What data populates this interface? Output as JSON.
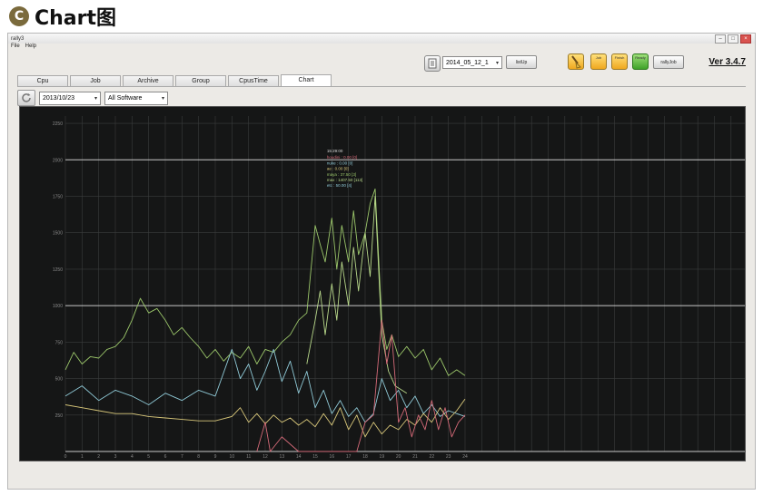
{
  "heading": {
    "badge": "C",
    "text": "Chart图"
  },
  "window": {
    "title": "rally3",
    "menu": [
      "File",
      "Help"
    ],
    "version": "Ver 3.4.7"
  },
  "toolbar": {
    "run_select": "2014_05_12_1",
    "load_label": "listUp",
    "folder_buttons": [
      "Job",
      "Finish",
      "Ready"
    ],
    "rally_job_label": "rallyJob"
  },
  "tabs": [
    {
      "label": "Cpu",
      "active": false
    },
    {
      "label": "Job",
      "active": false
    },
    {
      "label": "Archive",
      "active": false
    },
    {
      "label": "Group",
      "active": false
    },
    {
      "label": "CpusTime",
      "active": false
    },
    {
      "label": "Chart",
      "active": true
    }
  ],
  "filters": {
    "date": "2013/10/23",
    "software": "All Software"
  },
  "colors": {
    "green": "#9bc66a",
    "lightgreen": "#b8d88a",
    "cyan": "#8fc9d6",
    "yellow": "#d8c77a",
    "pink": "#d46a78",
    "grid": "#3a3c3c",
    "major": "#c8c8c8"
  },
  "chart_data": {
    "type": "line",
    "x_ticks": [
      "0",
      "1",
      "2",
      "3",
      "4",
      "5",
      "6",
      "7",
      "8",
      "9",
      "10",
      "11",
      "12",
      "13",
      "14",
      "15",
      "16",
      "17",
      "18",
      "19",
      "20",
      "21",
      "22",
      "23",
      "24"
    ],
    "y_ticks": [
      "250",
      "500",
      "750",
      "1000",
      "1250",
      "1500",
      "1750",
      "2000",
      "2250"
    ],
    "xlim": [
      0,
      24
    ],
    "ylim": [
      0,
      2300
    ],
    "grid": true,
    "tooltip": {
      "time": "15:29:00",
      "lines": [
        "houdini : 0.00 [0]",
        "nuke : 0.00 [0]",
        "ae : 0.00 [0]",
        "maya : 37.50 [3]",
        "max : 1407.50 [113]",
        "etc : 50.00 [4]"
      ]
    },
    "series": [
      {
        "color": "green",
        "values": [
          [
            0,
            560
          ],
          [
            0.5,
            680
          ],
          [
            1,
            600
          ],
          [
            1.5,
            650
          ],
          [
            2,
            640
          ],
          [
            2.5,
            700
          ],
          [
            3,
            720
          ],
          [
            3.5,
            780
          ],
          [
            4,
            900
          ],
          [
            4.5,
            1050
          ],
          [
            5,
            950
          ],
          [
            5.5,
            980
          ],
          [
            6,
            900
          ],
          [
            6.5,
            800
          ],
          [
            7,
            850
          ],
          [
            7.5,
            780
          ],
          [
            8,
            720
          ],
          [
            8.5,
            640
          ],
          [
            9,
            700
          ],
          [
            9.5,
            620
          ],
          [
            10,
            680
          ],
          [
            10.5,
            640
          ],
          [
            11,
            720
          ],
          [
            11.5,
            600
          ],
          [
            12,
            700
          ],
          [
            12.5,
            680
          ],
          [
            13,
            750
          ],
          [
            13.5,
            800
          ],
          [
            14,
            900
          ],
          [
            14.5,
            950
          ],
          [
            15,
            1550
          ],
          [
            15.3,
            1420
          ],
          [
            15.6,
            1300
          ],
          [
            16,
            1600
          ],
          [
            16.3,
            1250
          ],
          [
            16.6,
            1550
          ],
          [
            17,
            1300
          ],
          [
            17.3,
            1650
          ],
          [
            17.6,
            1350
          ],
          [
            18,
            1500
          ],
          [
            18.3,
            1700
          ],
          [
            18.6,
            1800
          ],
          [
            19,
            900
          ],
          [
            19.3,
            700
          ],
          [
            19.6,
            800
          ],
          [
            20,
            650
          ],
          [
            20.5,
            720
          ],
          [
            21,
            640
          ],
          [
            21.5,
            700
          ],
          [
            22,
            560
          ],
          [
            22.5,
            640
          ],
          [
            23,
            520
          ],
          [
            23.5,
            560
          ],
          [
            24,
            520
          ]
        ]
      },
      {
        "color": "lightgreen",
        "values": [
          [
            14.5,
            600
          ],
          [
            15,
            900
          ],
          [
            15.3,
            1100
          ],
          [
            15.6,
            800
          ],
          [
            16,
            1150
          ],
          [
            16.3,
            900
          ],
          [
            16.6,
            1300
          ],
          [
            17,
            1000
          ],
          [
            17.3,
            1400
          ],
          [
            17.6,
            1100
          ],
          [
            18,
            1500
          ],
          [
            18.3,
            1200
          ],
          [
            18.6,
            1750
          ],
          [
            19,
            800
          ],
          [
            19.4,
            550
          ],
          [
            19.8,
            450
          ],
          [
            20.5,
            400
          ]
        ]
      },
      {
        "color": "cyan",
        "values": [
          [
            0,
            380
          ],
          [
            1,
            450
          ],
          [
            2,
            350
          ],
          [
            3,
            420
          ],
          [
            4,
            380
          ],
          [
            5,
            320
          ],
          [
            6,
            400
          ],
          [
            7,
            350
          ],
          [
            8,
            420
          ],
          [
            9,
            380
          ],
          [
            10,
            700
          ],
          [
            10.5,
            500
          ],
          [
            11,
            600
          ],
          [
            11.5,
            420
          ],
          [
            12,
            550
          ],
          [
            12.5,
            700
          ],
          [
            13,
            480
          ],
          [
            13.5,
            620
          ],
          [
            14,
            400
          ],
          [
            14.5,
            550
          ],
          [
            15,
            300
          ],
          [
            15.5,
            420
          ],
          [
            16,
            260
          ],
          [
            16.5,
            350
          ],
          [
            17,
            240
          ],
          [
            17.5,
            300
          ],
          [
            18,
            200
          ],
          [
            18.5,
            260
          ],
          [
            19,
            500
          ],
          [
            19.5,
            350
          ],
          [
            20,
            420
          ],
          [
            20.5,
            300
          ],
          [
            21,
            380
          ],
          [
            21.5,
            260
          ],
          [
            22,
            320
          ],
          [
            22.5,
            240
          ],
          [
            23,
            280
          ],
          [
            24,
            240
          ]
        ]
      },
      {
        "color": "yellow",
        "values": [
          [
            0,
            320
          ],
          [
            1,
            300
          ],
          [
            2,
            280
          ],
          [
            3,
            260
          ],
          [
            4,
            260
          ],
          [
            5,
            240
          ],
          [
            6,
            230
          ],
          [
            7,
            220
          ],
          [
            8,
            210
          ],
          [
            9,
            210
          ],
          [
            10,
            240
          ],
          [
            10.5,
            300
          ],
          [
            11,
            200
          ],
          [
            11.5,
            260
          ],
          [
            12,
            190
          ],
          [
            12.5,
            250
          ],
          [
            13,
            200
          ],
          [
            13.5,
            230
          ],
          [
            14,
            180
          ],
          [
            14.5,
            220
          ],
          [
            15,
            170
          ],
          [
            15.5,
            260
          ],
          [
            16,
            180
          ],
          [
            16.5,
            300
          ],
          [
            17,
            150
          ],
          [
            17.5,
            250
          ],
          [
            18,
            100
          ],
          [
            18.5,
            200
          ],
          [
            19,
            120
          ],
          [
            19.5,
            180
          ],
          [
            20,
            150
          ],
          [
            20.5,
            220
          ],
          [
            21,
            180
          ],
          [
            21.5,
            260
          ],
          [
            22,
            200
          ],
          [
            22.5,
            300
          ],
          [
            23,
            220
          ],
          [
            23.5,
            280
          ],
          [
            24,
            360
          ]
        ]
      },
      {
        "color": "pink",
        "values": [
          [
            11.5,
            0
          ],
          [
            12,
            200
          ],
          [
            12.3,
            0
          ],
          [
            13,
            100
          ],
          [
            14,
            0
          ],
          [
            17.5,
            0
          ],
          [
            18,
            200
          ],
          [
            18.5,
            250
          ],
          [
            19,
            900
          ],
          [
            19.3,
            600
          ],
          [
            19.6,
            800
          ],
          [
            20,
            200
          ],
          [
            20.4,
            300
          ],
          [
            20.8,
            100
          ],
          [
            21.2,
            250
          ],
          [
            21.6,
            150
          ],
          [
            22,
            350
          ],
          [
            22.4,
            150
          ],
          [
            22.8,
            300
          ],
          [
            23.2,
            100
          ],
          [
            23.6,
            200
          ],
          [
            24,
            250
          ]
        ]
      }
    ]
  }
}
